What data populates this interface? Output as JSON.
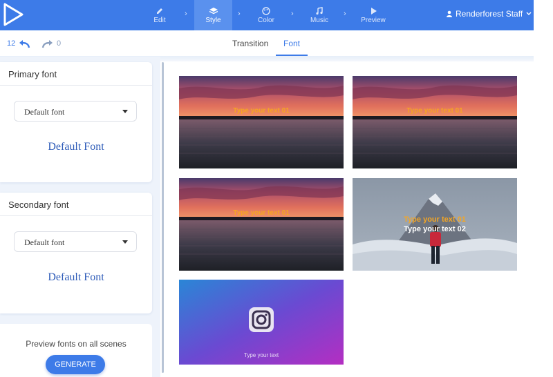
{
  "header": {
    "steps": [
      {
        "label": "Edit",
        "icon": "pencil-icon"
      },
      {
        "label": "Style",
        "icon": "layers-icon"
      },
      {
        "label": "Color",
        "icon": "palette-icon"
      },
      {
        "label": "Music",
        "icon": "music-note-icon"
      },
      {
        "label": "Preview",
        "icon": "play-icon"
      }
    ],
    "user_name": "Renderforest Staff"
  },
  "history": {
    "undo_count": "12",
    "redo_count": "0"
  },
  "tabs": [
    {
      "label": "Transition",
      "active": false
    },
    {
      "label": "Font",
      "active": true
    }
  ],
  "primary": {
    "title": "Primary font",
    "selected": "Default font",
    "preview": "Default Font"
  },
  "secondary": {
    "title": "Secondary font",
    "selected": "Default font",
    "preview": "Default Font"
  },
  "generate": {
    "text": "Preview fonts on all scenes",
    "button": "GENERATE"
  },
  "scenes": [
    {
      "text1": "Type your text 01"
    },
    {
      "text1": "Type your text 01"
    },
    {
      "text1": "Type your text 01"
    },
    {
      "text1": "Type your text 01",
      "text2": "Type your text 02"
    },
    {
      "caption": "Type your text"
    }
  ],
  "colors": {
    "accent": "#3d7be8",
    "scene_text": "#f5a623"
  }
}
